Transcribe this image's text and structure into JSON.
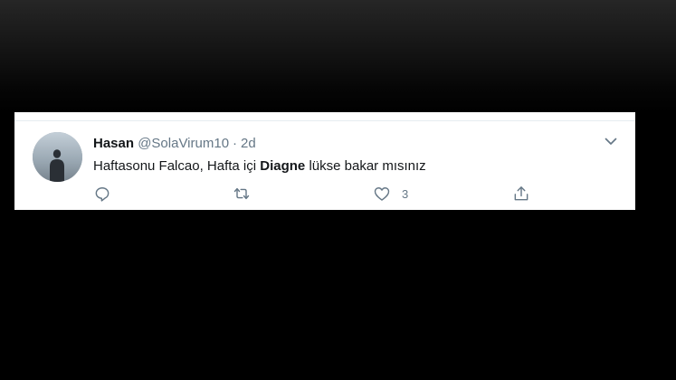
{
  "tweet": {
    "author": {
      "display_name": "Hasan",
      "handle": "@SolaVirum10"
    },
    "separator": "·",
    "timestamp": "2d",
    "text_part1": "Haftasonu Falcao, Hafta içi ",
    "text_bold": "Diagne",
    "text_part2": " lükse bakar mısınız",
    "actions": {
      "reply_icon": "reply-icon",
      "retweet_icon": "retweet-icon",
      "like_icon": "heart-icon",
      "like_count": "3",
      "share_icon": "share-icon"
    },
    "menu_icon": "chevron-down-icon"
  },
  "colors": {
    "background": "#000000",
    "card": "#ffffff",
    "text_primary": "#14171a",
    "text_secondary": "#657786",
    "icon": "#657786"
  }
}
